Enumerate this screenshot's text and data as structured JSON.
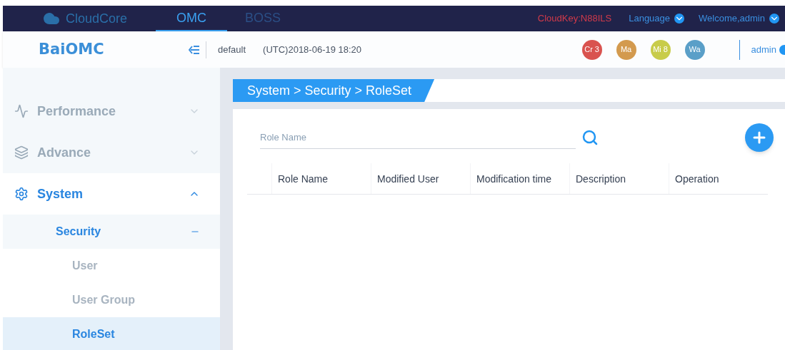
{
  "topbar": {
    "brand": "CloudCore",
    "tabs": [
      {
        "label": "OMC",
        "selected": true
      },
      {
        "label": "BOSS",
        "selected": false
      }
    ],
    "cloudkey": "CloudKey:N88ILS",
    "language": "Language",
    "welcome": "Welcome,admin"
  },
  "header": {
    "logo": "BaiOMC",
    "domain": "default",
    "time": "(UTC)2018-06-19 18:20",
    "alarms": [
      {
        "label": "Cr 3",
        "color": "#d9534f"
      },
      {
        "label": "Ma",
        "color": "#d39a4e"
      },
      {
        "label": "Mi 8",
        "color": "#c8cc4a"
      },
      {
        "label": "Wa",
        "color": "#5a9fc8"
      }
    ],
    "user": "admin"
  },
  "sidebar": {
    "items": [
      {
        "label": "Performance",
        "kind": "pulse",
        "expanded": false
      },
      {
        "label": "Advance",
        "kind": "layers",
        "expanded": false
      },
      {
        "label": "System",
        "kind": "gears",
        "expanded": true,
        "children": [
          {
            "label": "Security",
            "expanded": true,
            "children": [
              {
                "label": "User",
                "selected": false
              },
              {
                "label": "User Group",
                "selected": false
              },
              {
                "label": "RoleSet",
                "selected": true
              }
            ]
          }
        ]
      }
    ]
  },
  "breadcrumb": "System > Security > RoleSet",
  "search": {
    "placeholder": "Role Name"
  },
  "table": {
    "columns": [
      "Role Name",
      "Modified User",
      "Modification time",
      "Description",
      "Operation"
    ]
  }
}
